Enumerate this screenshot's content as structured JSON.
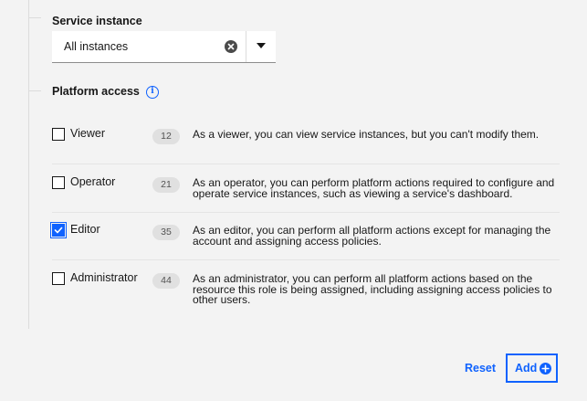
{
  "service_instance": {
    "label": "Service instance",
    "selected_value": "All instances"
  },
  "platform_access": {
    "label": "Platform access",
    "roles": [
      {
        "name": "Viewer",
        "count": "12",
        "checked": false,
        "description": "As a viewer, you can view service instances, but you can't modify them."
      },
      {
        "name": "Operator",
        "count": "21",
        "checked": false,
        "description": "As an operator, you can perform platform actions required to configure and operate service instances, such as viewing a service's dashboard."
      },
      {
        "name": "Editor",
        "count": "35",
        "checked": true,
        "description": "As an editor, you can perform all platform actions except for managing the account and assigning access policies."
      },
      {
        "name": "Administrator",
        "count": "44",
        "checked": false,
        "description": "As an administrator, you can perform all platform actions based on the resource this role is being assigned, including assigning access policies to other users."
      }
    ]
  },
  "footer": {
    "reset_label": "Reset",
    "add_label": "Add"
  },
  "colors": {
    "accent": "#0f62fe",
    "background": "#f3f3f3"
  }
}
